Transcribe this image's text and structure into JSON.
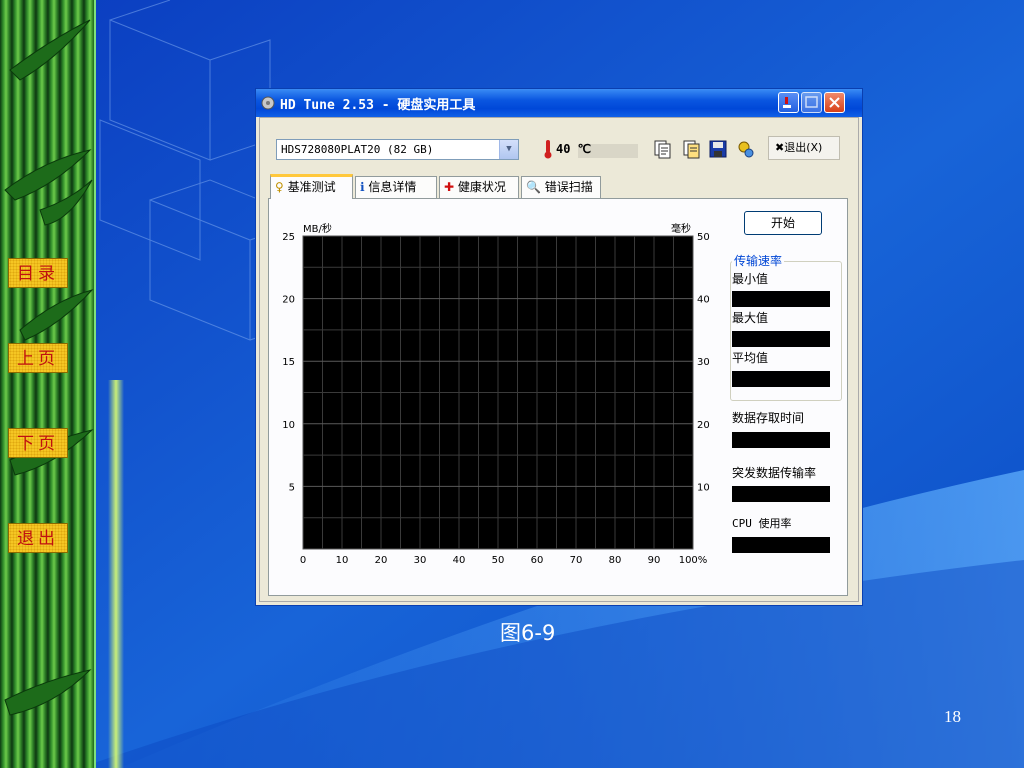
{
  "slide": {
    "caption": "图6-9",
    "page_number": "18",
    "colors": {
      "background": "#1a5fd8",
      "nav_button": "#f5c623",
      "nav_text": "#c01010"
    }
  },
  "nav": {
    "items": [
      {
        "label": "目录"
      },
      {
        "label": "上页"
      },
      {
        "label": "下页"
      },
      {
        "label": "退出"
      }
    ]
  },
  "window": {
    "title": "HD Tune 2.53 - 硬盘实用工具",
    "drive": {
      "selected": "HDS728080PLAT20 (82 GB)"
    },
    "temperature": "40 ℃",
    "exit_label": "✖退出(X)",
    "tabs": [
      {
        "label": "基准测试",
        "icon": "lightbulb-icon",
        "active": true
      },
      {
        "label": "信息详情",
        "icon": "info-icon",
        "active": false
      },
      {
        "label": "健康状况",
        "icon": "red-cross-icon",
        "active": false
      },
      {
        "label": "错误扫描",
        "icon": "magnifier-icon",
        "active": false
      }
    ],
    "start_label": "开始",
    "stats": {
      "transfer_group": "传输速率",
      "min": "最小值",
      "max": "最大值",
      "avg": "平均值",
      "access_time": "数据存取时间",
      "burst_rate": "突发数据传输率",
      "cpu_usage": "CPU 使用率"
    }
  },
  "chart_data": {
    "type": "line",
    "series": [],
    "left_unit": "MB/秒",
    "right_unit": "毫秒",
    "x_ticks": [
      "0",
      "10",
      "20",
      "30",
      "40",
      "50",
      "60",
      "70",
      "80",
      "90",
      "100%"
    ],
    "y_left_ticks": [
      "25",
      "20",
      "15",
      "10",
      "5"
    ],
    "y_right_ticks": [
      "50",
      "40",
      "30",
      "20",
      "10"
    ],
    "ylim_left": [
      0,
      25
    ],
    "ylim_right": [
      0,
      50
    ],
    "xlim": [
      0,
      100
    ],
    "grid": true
  }
}
